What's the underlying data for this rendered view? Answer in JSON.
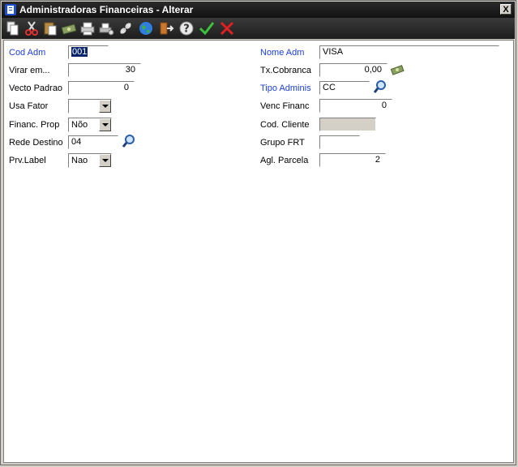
{
  "window": {
    "title": "Administradoras Financeiras - Alterar",
    "close_label": "X"
  },
  "toolbar": {
    "icons": [
      "copy-icon",
      "cut-icon",
      "paste-icon",
      "money-icon",
      "print-icon",
      "printer-setup-icon",
      "link-icon",
      "globe-icon",
      "exit-icon",
      "help-icon",
      "confirm-icon",
      "cancel-icon"
    ],
    "accent_confirm": "#3cc13c",
    "accent_cancel": "#e02020"
  },
  "form": {
    "left": {
      "cod_adm": {
        "label": "Cod Adm",
        "value": "001"
      },
      "virar_em": {
        "label": "Virar em...",
        "value": "30"
      },
      "vecto_padrao": {
        "label": "Vecto Padrao",
        "value": "0"
      },
      "usa_fator": {
        "label": "Usa Fator",
        "value": ""
      },
      "financ_prop": {
        "label": "Financ. Prop",
        "value": "Nõo"
      },
      "rede_destino": {
        "label": "Rede Destino",
        "value": "04"
      },
      "prv_label": {
        "label": "Prv.Label",
        "value": "Nao"
      }
    },
    "right": {
      "nome_adm": {
        "label": "Nome Adm",
        "value": "VISA"
      },
      "tx_cobranca": {
        "label": "Tx.Cobranca",
        "value": "0,00"
      },
      "tipo_adminis": {
        "label": "Tipo Adminis",
        "value": "CC"
      },
      "venc_financ": {
        "label": "Venc Financ",
        "value": "0"
      },
      "cod_cliente": {
        "label": "Cod. Cliente",
        "value": ""
      },
      "grupo_frt": {
        "label": "Grupo FRT",
        "value": ""
      },
      "agl_parcela": {
        "label": "Agl. Parcela",
        "value": "2"
      }
    }
  },
  "colors": {
    "required_label": "#1b3fd6",
    "selection": "#0a246a",
    "titlebar": "#1a1a1a"
  }
}
